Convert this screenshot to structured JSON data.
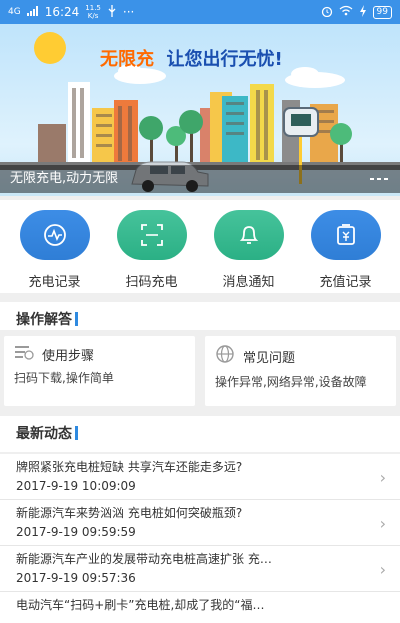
{
  "status_bar": {
    "network": "4G",
    "time": "16:24",
    "speed": "11.5",
    "speed_unit": "K/s",
    "more": "···",
    "battery": "99"
  },
  "banner": {
    "title_part1": "无限充",
    "title_part2": "让您出行无忧!",
    "caption": "无限充电,动力无限"
  },
  "quick_actions": [
    {
      "label": "充电记录",
      "icon": "pulse-icon"
    },
    {
      "label": "扫码充电",
      "icon": "scan-icon"
    },
    {
      "label": "消息通知",
      "icon": "bell-icon"
    },
    {
      "label": "充值记录",
      "icon": "yen-icon"
    }
  ],
  "help_section": {
    "title": "操作解答",
    "cards": [
      {
        "title": "使用步骤",
        "desc": "扫码下载,操作简单",
        "icon": "steps-icon"
      },
      {
        "title": "常见问题",
        "desc": "操作异常,网络异常,设备故障",
        "icon": "globe-icon"
      }
    ]
  },
  "news_section": {
    "title": "最新动态",
    "items": [
      {
        "title": "牌照紧张充电桩短缺 共享汽车还能走多远?",
        "date": "2017-9-19 10:09:09"
      },
      {
        "title": "新能源汽车来势汹汹 充电桩如何突破瓶颈?",
        "date": "2017-9-19 09:59:59"
      },
      {
        "title": "新能源汽车产业的发展带动充电桩高速扩张 充…",
        "date": "2017-9-19 09:57:36"
      },
      {
        "title": "电动汽车“扫码+刷卡”充电桩,却成了我的“福…",
        "date": ""
      }
    ]
  },
  "colors": {
    "primary": "#3b92e8",
    "accent_green": "#2bb085",
    "background": "#efefef"
  }
}
